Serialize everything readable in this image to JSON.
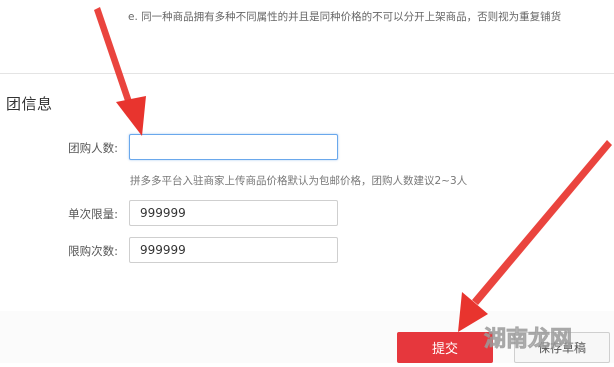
{
  "top_note": "e. 同一种商品拥有多种不同属性的并且是同种价格的不可以分开上架商品，否则视为重复铺货",
  "section": {
    "title": "团信息"
  },
  "fields": {
    "group_size": {
      "label": "团购人数:",
      "value": ""
    },
    "hint": "拼多多平台入驻商家上传商品价格默认为包邮价格，团购人数建议2~3人",
    "single_limit": {
      "label": "单次限量:",
      "value": "999999"
    },
    "purchase_limit": {
      "label": "限购次数:",
      "value": "999999"
    }
  },
  "buttons": {
    "submit": "提交",
    "save_draft": "保存草稿"
  },
  "watermark_text": "湖南龙网",
  "colors": {
    "submit_bg": "#e6373d",
    "arrow": "#e8342e",
    "focus_border": "#6aa8ec"
  }
}
